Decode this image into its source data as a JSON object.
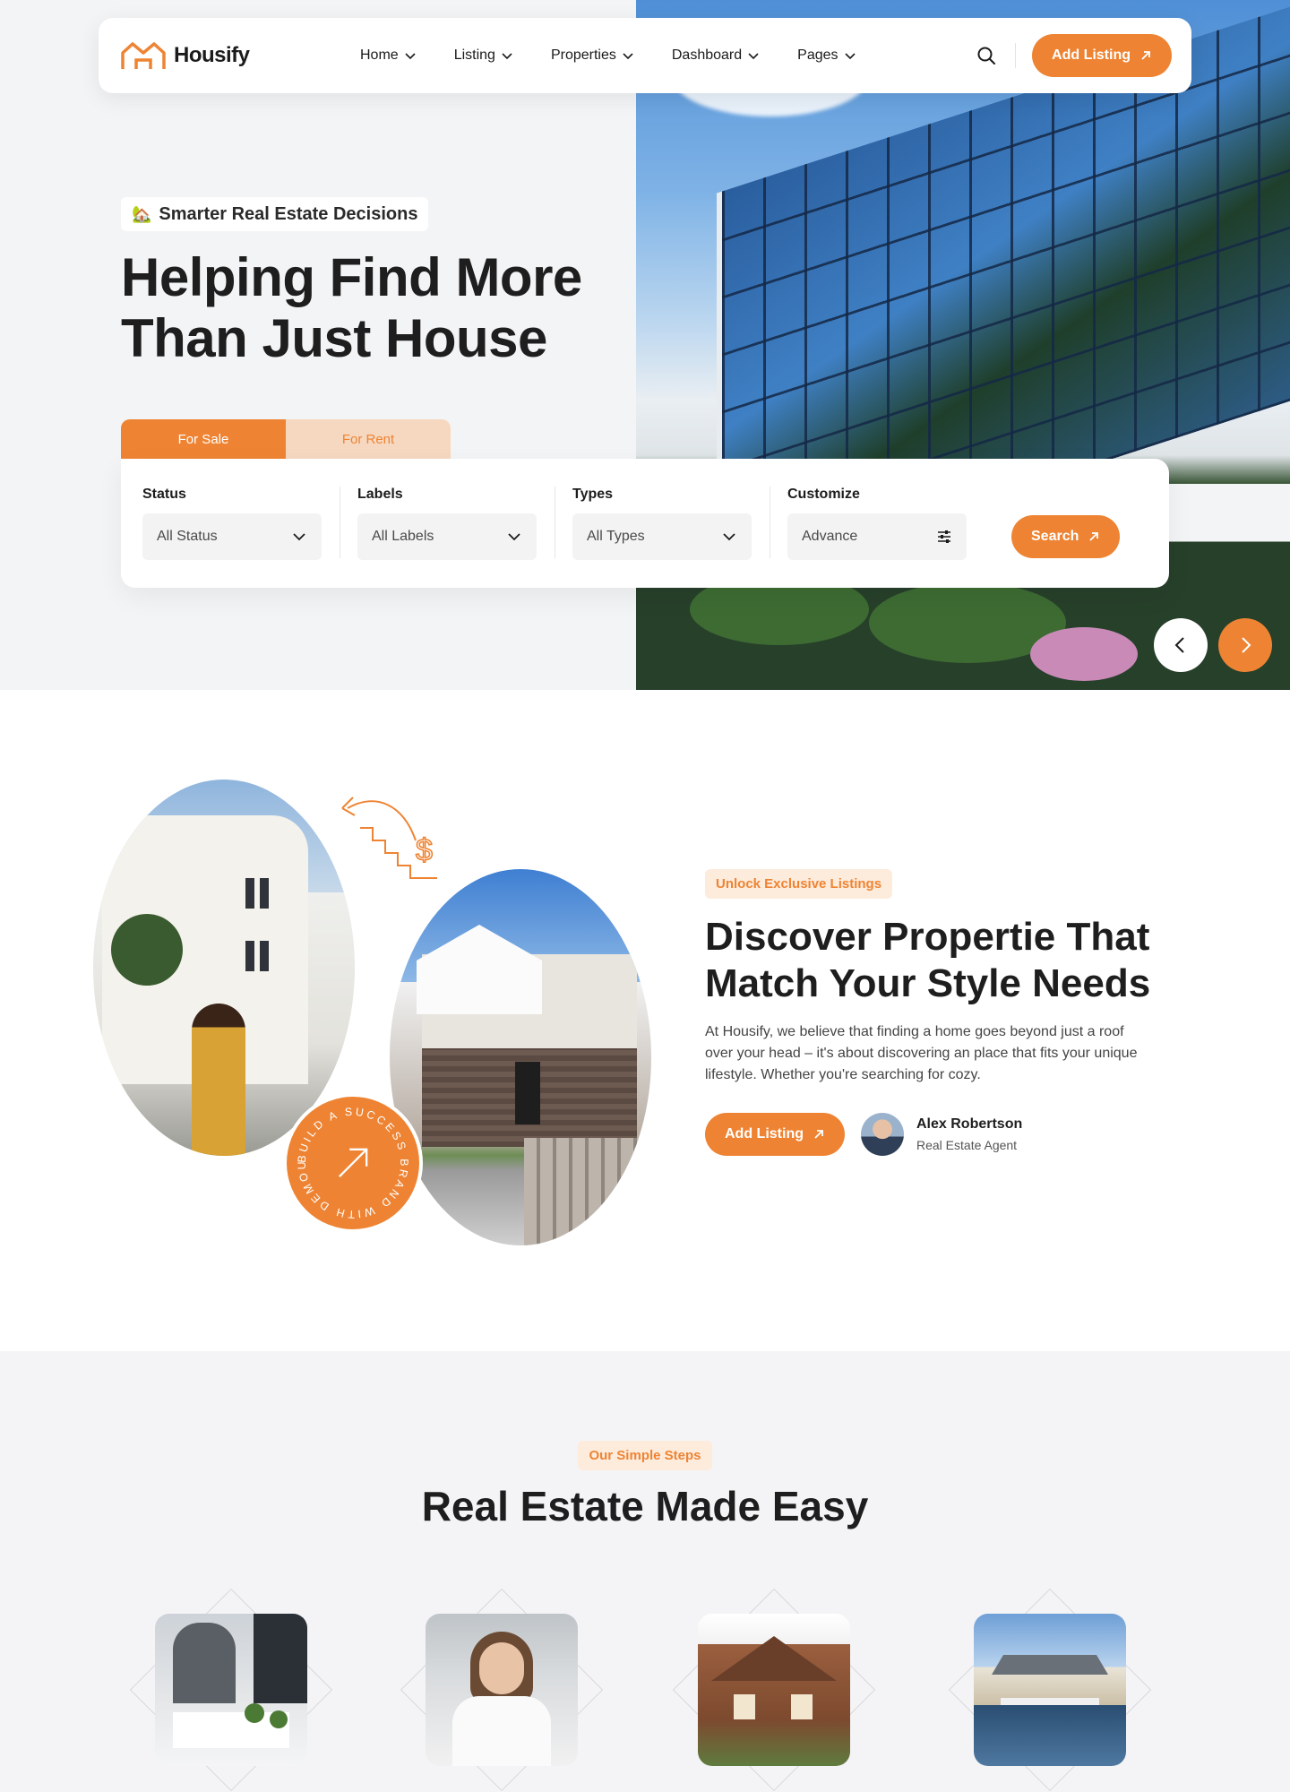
{
  "brand": {
    "name": "Housify",
    "accent": "#ee8433"
  },
  "nav": {
    "items": [
      "Home",
      "Listing",
      "Properties",
      "Dashboard",
      "Pages"
    ],
    "cta": "Add Listing"
  },
  "hero": {
    "tag_emoji": "🏡",
    "tag": "Smarter Real Estate Decisions",
    "title": "Helping Find More Than Just House",
    "tabs": {
      "active": "For Sale",
      "inactive": "For Rent"
    },
    "fields": [
      {
        "label": "Status",
        "value": "All Status",
        "icon": "chevron-down-icon"
      },
      {
        "label": "Labels",
        "value": "All Labels",
        "icon": "chevron-down-icon"
      },
      {
        "label": "Types",
        "value": "All Types",
        "icon": "chevron-down-icon"
      },
      {
        "label": "Customize",
        "value": "Advance",
        "icon": "sliders-icon"
      }
    ],
    "search_button": "Search"
  },
  "about": {
    "tag": "Unlock Exclusive Listings",
    "title": "Discover Propertie That Match Your Style Needs",
    "text": "At Housify, we believe that finding a home goes beyond just a roof over your head – it's about discovering an place that fits your unique lifestyle. Whether you're searching for cozy.",
    "cta": "Add Listing",
    "badge_text": "BUILD A SUCCESS BRAND WITH DEMOUI ",
    "agent": {
      "name": "Alex Robertson",
      "role": "Real Estate Agent"
    }
  },
  "steps": {
    "tag": "Our Simple Steps",
    "title": "Real Estate Made Easy"
  }
}
